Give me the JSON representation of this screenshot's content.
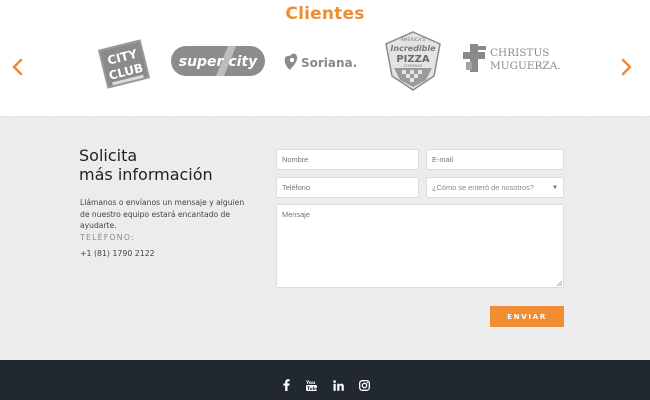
{
  "clients": {
    "title": "Clientes",
    "logos": {
      "cityclub_line1": "CITY",
      "cityclub_line2": "CLUB",
      "supercity": "super city",
      "soriana": "Soriana.",
      "pizza_top": "AMERICA'S",
      "pizza_line1": "Incredible",
      "pizza_line2": "PIZZA",
      "pizza_bottom": "COMPANY",
      "christus_line1": "CHRISTUS",
      "christus_line2": "MUGUERZA."
    },
    "icons": {
      "prev": "chevron-left-icon",
      "next": "chevron-right-icon"
    },
    "accent_color": "#f08c32"
  },
  "request": {
    "title_line1": "Solicita",
    "title_line2": "más información",
    "description": "Llámanos o envíanos un mensaje y alguien de nuestro equipo estará encantado de ayudarte.",
    "phone_label": "TELÉFONO:",
    "phone_value": "+1 (81) 1790 2122"
  },
  "form": {
    "nombre_placeholder": "Nombre",
    "email_placeholder": "E-mail",
    "telefono_placeholder": "Teléfono",
    "select_value": "¿Cómo se enteró de nosotros?",
    "mensaje_placeholder": "Mensaje",
    "submit_label": "ENVIAR"
  },
  "footer": {
    "social_icons": [
      "facebook-icon",
      "youtube-icon",
      "linkedin-icon",
      "instagram-icon"
    ],
    "background": "#212832"
  }
}
